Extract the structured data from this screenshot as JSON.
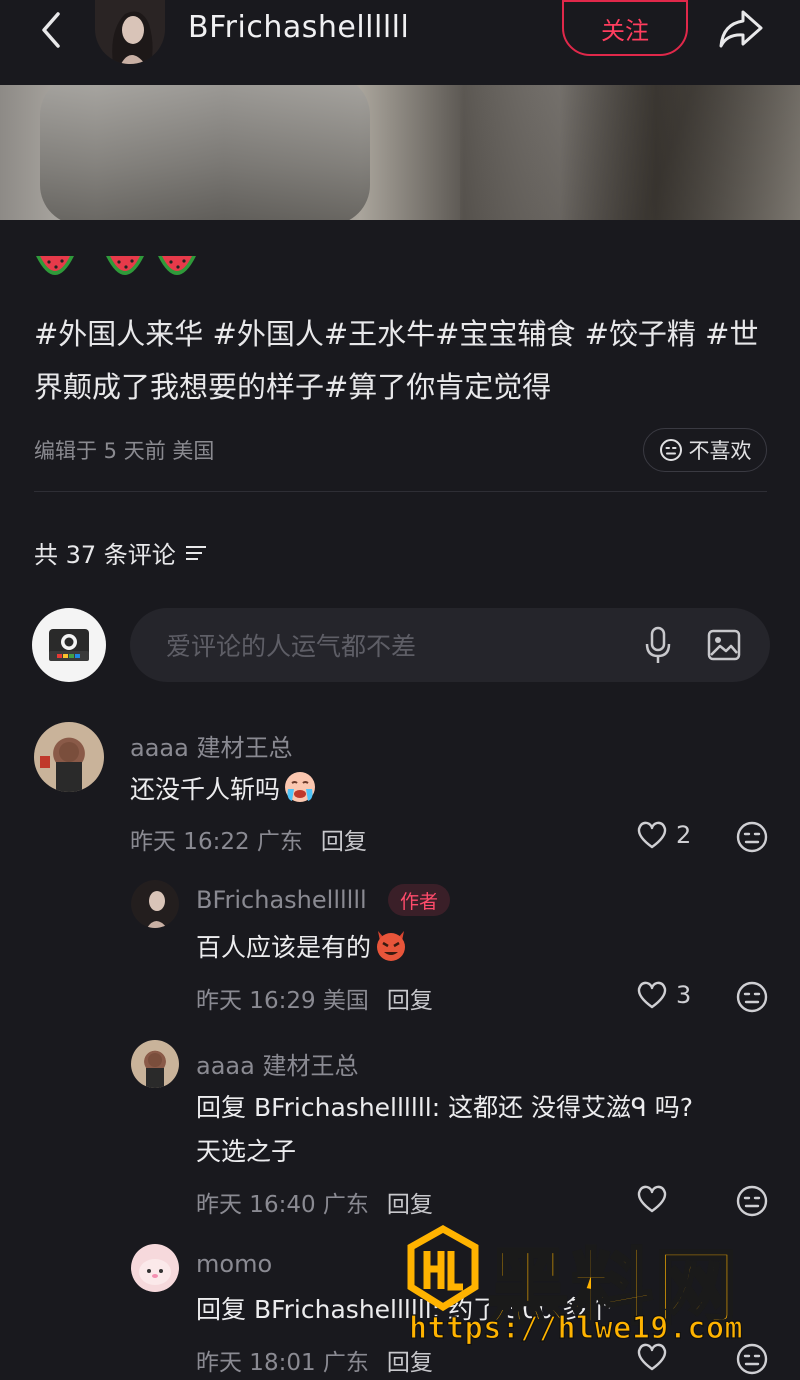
{
  "header": {
    "author_name": "BFrichashellllll",
    "follow_label": "关注"
  },
  "post": {
    "emojis": [
      "watermelon",
      "watermelon",
      "watermelon"
    ],
    "hashtags": "#外国人来华 #外国人#王水牛#宝宝辅食 #饺子精 #世界颠成了我想要的样子#算了你肯定觉得",
    "meta": "编辑于 5 天前 美国",
    "dislike_label": "不喜欢"
  },
  "comments_header": {
    "count_label": "共 37 条评论"
  },
  "comment_input": {
    "placeholder": "爱评论的人运气都不差"
  },
  "comments": [
    {
      "user": "aaaa 建材王总",
      "text": "还没千人斩吗",
      "time_loc": "昨天 16:22 广东",
      "reply_label": "回复",
      "likes": "2",
      "emoji": "crying-face"
    },
    {
      "user": "BFrichashellllll",
      "badge": "作者",
      "text": "百人应该是有的",
      "time_loc": "昨天 16:29 美国",
      "reply_label": "回复",
      "likes": "3",
      "emoji": "devil-face"
    },
    {
      "user": "aaaa 建材王总",
      "text_line1": "回复 BFrichashellllll: 这都还 没得艾滋ᑫ 吗?",
      "text_line2": "天选之子",
      "time_loc": "昨天 16:40 广东",
      "reply_label": "回复"
    },
    {
      "user": "momo",
      "text": "回复 BFrichashellllll: 约了 300 多个",
      "time_loc": "昨天 18:01 广东",
      "reply_label": "回复"
    }
  ],
  "watermark": {
    "title": "黑料网",
    "url": "https://hlwe19.com"
  },
  "colors": {
    "background": "#19191e",
    "accent": "#ff3d5e",
    "watermark": "#ffb300"
  }
}
